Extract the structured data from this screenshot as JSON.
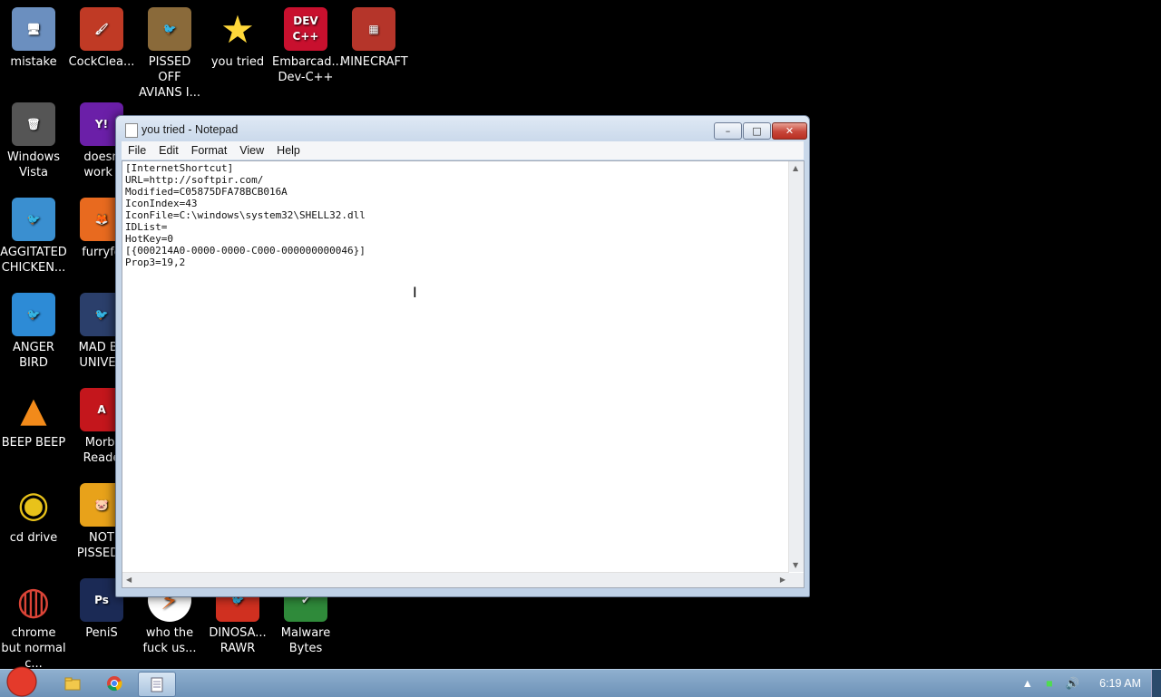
{
  "desktop": {
    "icons": [
      {
        "label": "mistake",
        "icon": "computer-icon",
        "color": "#6b8fbf"
      },
      {
        "label": "CockClea...",
        "icon": "brush-icon",
        "color": "#c03a25"
      },
      {
        "label": "PISSED OFF AVIANS I...",
        "icon": "angry-bird-seasons-icon",
        "color": "#8a6a3a"
      },
      {
        "label": "you tried",
        "icon": "star-icon",
        "color": "#000000"
      },
      {
        "label": "Embarcad... Dev-C++",
        "icon": "devcpp-icon",
        "color": "#c8102e"
      },
      {
        "label": "MINECRAFT",
        "icon": "minecraft-icon",
        "color": "#b5352a"
      },
      {
        "label": "Windows Vista",
        "icon": "trash-icon",
        "color": "#555555"
      },
      {
        "label": "doesn work l",
        "icon": "yahoo-icon",
        "color": "#6b1fa8"
      },
      {
        "label": "AGGITATED CHICKEN...",
        "icon": "angry-bird-icon",
        "color": "#3a8fd0"
      },
      {
        "label": "furryfo",
        "icon": "firefox-icon",
        "color": "#e86a1f"
      },
      {
        "label": "ANGER BIRD",
        "icon": "angry-bird-icon",
        "color": "#2d8bd6"
      },
      {
        "label": "MAD BII UNIVER",
        "icon": "angry-bird-space-icon",
        "color": "#2b3f6b"
      },
      {
        "label": "BEEP BEEP",
        "icon": "vlc-icon",
        "color": "#000000"
      },
      {
        "label": "Morbi Reade",
        "icon": "acrobat-icon",
        "color": "#c4161c"
      },
      {
        "label": "cd drive",
        "icon": "cd-icon",
        "color": "#000000"
      },
      {
        "label": "NOT PISSED I",
        "icon": "bad-piggies-icon",
        "color": "#e8a21a"
      },
      {
        "label": "chrome but normal c...",
        "icon": "chrome-icon",
        "color": "#000000"
      },
      {
        "label": "PeniS",
        "icon": "photoshop-icon",
        "color": "#1b2a55"
      },
      {
        "label": "who the fuck us...",
        "icon": "lightning-icon",
        "color": "#ffffff"
      },
      {
        "label": "DINOSA... RAWR",
        "icon": "angry-bird-icon",
        "color": "#d03020"
      },
      {
        "label": "Malware Bytes",
        "icon": "shield-icon",
        "color": "#2f8a3a"
      }
    ]
  },
  "window": {
    "title": "you tried - Notepad",
    "minimize": "–",
    "maximize": "□",
    "close": "✕",
    "menu": [
      "File",
      "Edit",
      "Format",
      "View",
      "Help"
    ],
    "content": "[InternetShortcut]\nURL=http://softpir.com/\nModified=C05875DFA78BCB016A\nIconIndex=43\nIconFile=C:\\windows\\system32\\SHELL32.dll\nIDList=\nHotKey=0\n[{000214A0-0000-0000-C000-000000000046}]\nProp3=19,2"
  },
  "taskbar": {
    "time": "6:19 AM",
    "items": [
      "explorer-icon",
      "chrome-icon",
      "notepad-icon"
    ]
  }
}
